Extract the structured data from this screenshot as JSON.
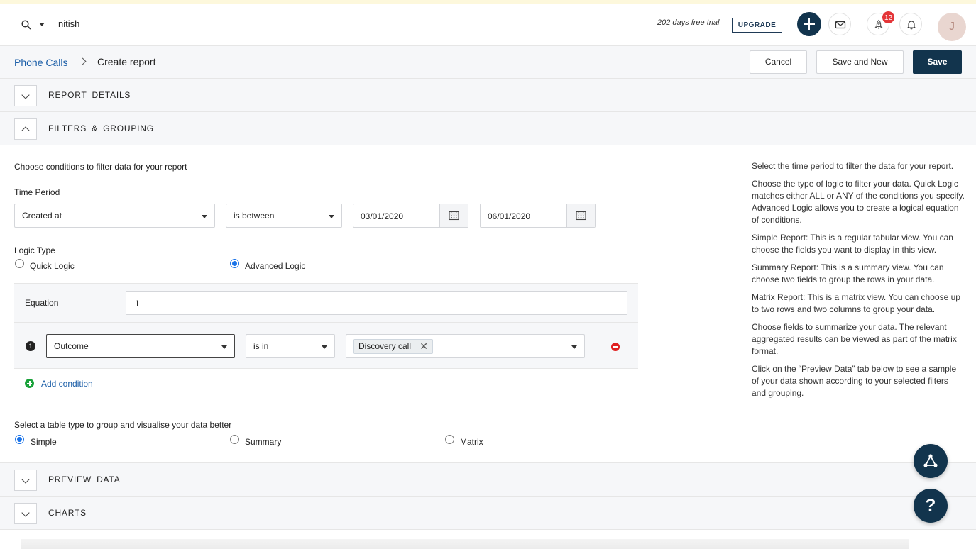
{
  "topbar": {
    "search_text": "nitish",
    "trial_text": "202 days free trial",
    "upgrade_label": "UPGRADE",
    "notification_count": "12",
    "avatar_initial": "J"
  },
  "breadcrumb": {
    "parent": "Phone Calls",
    "current": "Create report"
  },
  "actions": {
    "cancel": "Cancel",
    "save_and_new": "Save and New",
    "save": "Save"
  },
  "sections": {
    "report_details": "REPORT  DETAILS",
    "filters_grouping": "FILTERS  &  GROUPING",
    "preview_data": "PREVIEW  DATA",
    "charts": "CHARTS"
  },
  "filters": {
    "heading": "Choose conditions to filter data for your report",
    "time_period_label": "Time Period",
    "time_field": "Created at",
    "time_operator": "is between",
    "date_from": "03/01/2020",
    "date_to": "06/01/2020",
    "logic_type_label": "Logic Type",
    "logic_quick": "Quick Logic",
    "logic_advanced": "Advanced Logic",
    "equation_label": "Equation",
    "equation_value": "1",
    "condition": {
      "index": "1",
      "field": "Outcome",
      "operator": "is in",
      "value_chip": "Discovery call"
    },
    "add_condition": "Add condition",
    "table_type_label": "Select a table type to group and visualise your data better",
    "table_simple": "Simple",
    "table_summary": "Summary",
    "table_matrix": "Matrix"
  },
  "help": {
    "p1": "Select the time period to filter the data for your report.",
    "p2": "Choose the type of logic to filter your data. Quick Logic matches either ALL or ANY of the conditions you specify. Advanced Logic allows you to create a logical equation of conditions.",
    "p3": "Simple Report: This is a regular tabular view. You can choose the fields you want to display in this view.",
    "p4": "Summary Report: This is a summary view. You can choose two fields to group the rows in your data.",
    "p5": "Matrix Report: This is a matrix view. You can choose up to two rows and two columns to group your data.",
    "p6": "Choose fields to summarize your data. The relevant aggregated results can be viewed as part of the matrix format.",
    "p7": "Click on the “Preview Data” tab below to see a sample of your data shown according to your selected filters and grouping."
  },
  "fab": {
    "help_symbol": "?"
  },
  "colors": {
    "primary": "#12344d",
    "link": "#1c5fa8",
    "radio_selected": "#1a73e8",
    "badge": "#e43538",
    "add": "#1aa23a",
    "remove": "#e02121"
  }
}
